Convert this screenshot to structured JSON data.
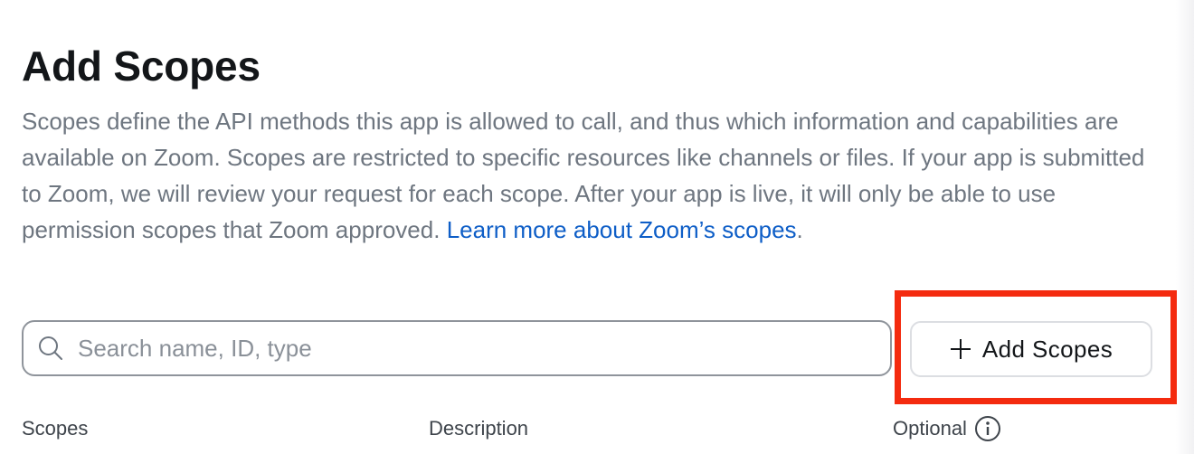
{
  "header": {
    "title": "Add Scopes",
    "description": "Scopes define the API methods this app is allowed to call, and thus which information and capabilities are available on Zoom. Scopes are restricted to specific resources like channels or files. If your app is submitted to Zoom, we will review your request for each scope. After your app is live, it will only be able to use permission scopes that Zoom approved. ",
    "learn_more_link": "Learn more about Zoom’s scopes",
    "description_end": "."
  },
  "search": {
    "placeholder": "Search name, ID, type",
    "value": "",
    "icon": "search-icon"
  },
  "add_button": {
    "label": "Add Scopes",
    "icon": "plus-icon"
  },
  "table": {
    "columns": [
      "Scopes",
      "Description",
      "Optional"
    ],
    "optional_info_icon": "info-icon"
  },
  "colors": {
    "link": "#0e5ec7",
    "highlight_box": "#f42b0f",
    "title_text": "#131619",
    "body_text": "#6e7680"
  }
}
